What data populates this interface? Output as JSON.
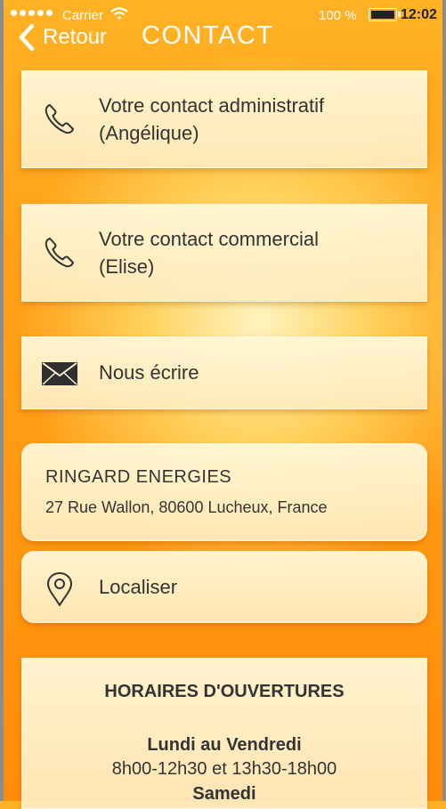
{
  "status_bar": {
    "carrier": "Carrier",
    "battery_percent": "100 %",
    "time": "12:02"
  },
  "nav": {
    "back_label": "Retour",
    "title": "CONTACT"
  },
  "contacts": [
    {
      "icon": "phone-icon",
      "line1": "Votre contact administratif",
      "line2": "(Angélique)"
    },
    {
      "icon": "phone-icon",
      "line1": "Votre contact commercial",
      "line2": "(Elise)"
    }
  ],
  "write": {
    "icon": "envelope-icon",
    "label": "Nous écrire"
  },
  "company": {
    "name": "RINGARD ENERGIES",
    "address": "27 Rue Wallon, 80600 Lucheux, France"
  },
  "locate": {
    "icon": "map-pin-icon",
    "label": "Localiser"
  },
  "hours": {
    "title": "HORAIRES D'OUVERTURES",
    "days": "Lundi au Vendredi",
    "times": "8h00-12h30 et 13h30-18h00",
    "days2": "Samedi"
  },
  "colors": {
    "background_top": "#ffb224",
    "background_bottom": "#ff8c08",
    "card": "#fff1cf",
    "text": "#333333",
    "header_text": "#ffffff"
  }
}
